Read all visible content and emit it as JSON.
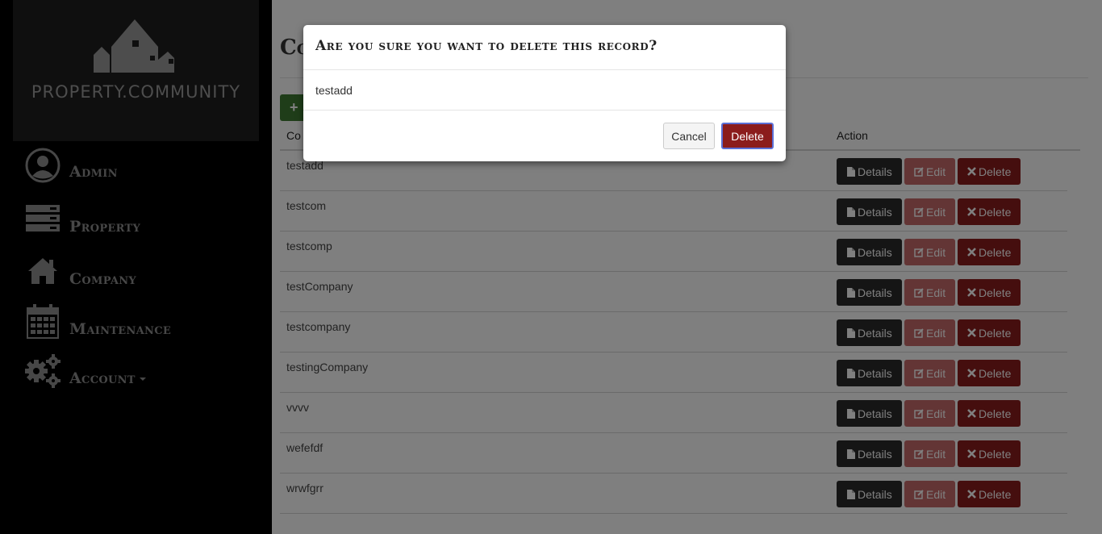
{
  "sidebar": {
    "logo_text": "PROPERTY.COMMUNITY",
    "items": [
      {
        "label": "Admin",
        "icon": "user-circle-icon"
      },
      {
        "label": "Property",
        "icon": "server-icon"
      },
      {
        "label": "Company",
        "icon": "home-icon"
      },
      {
        "label": "Maintenance",
        "icon": "calendar-icon"
      },
      {
        "label": "Account",
        "icon": "gears-icon"
      }
    ]
  },
  "main": {
    "title": "Co",
    "create_button_icon": "+",
    "columns": [
      "Co",
      "Action"
    ],
    "rows": [
      {
        "name": "testadd"
      },
      {
        "name": "testcom"
      },
      {
        "name": "testcomp"
      },
      {
        "name": "testCompany"
      },
      {
        "name": "testcompany"
      },
      {
        "name": "testingCompany"
      },
      {
        "name": "vvvv"
      },
      {
        "name": "wefefdf"
      },
      {
        "name": "wrwfgrr"
      }
    ],
    "action_labels": {
      "details": "Details",
      "edit": "Edit",
      "delete": "Delete"
    }
  },
  "modal": {
    "title": "Are you sure you want to delete this record?",
    "body": "testadd",
    "cancel_label": "Cancel",
    "delete_label": "Delete"
  },
  "colors": {
    "sidebar_bg": "#000000",
    "logo_bg": "#1f1f1f",
    "details_btn": "#2b2b2b",
    "edit_btn": "#c76a6a",
    "delete_btn": "#8b1c1c",
    "create_btn": "#3e7b33"
  }
}
